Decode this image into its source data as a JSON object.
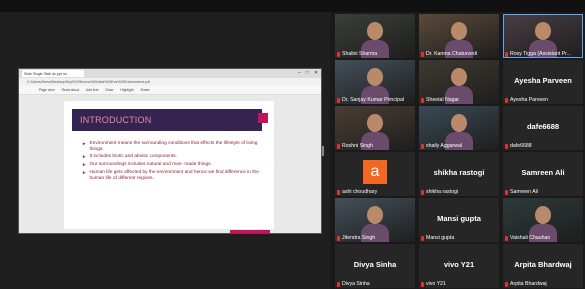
{
  "browser": {
    "tab_title": "Slide Single Slide dc.ppt mi...",
    "window_controls": [
      "–",
      "□",
      "✕"
    ],
    "address": "C:/Users/Hema/Desktop/Sep%20Shrena%20slide%20Evs%20Environment.pdf",
    "pdf_tools": [
      "Page view",
      "Read aloud",
      "Add text",
      "Draw",
      "Highlight",
      "Erase"
    ]
  },
  "slide": {
    "title": "INTRODUCTION",
    "bullets": [
      "Environment means the surrounding conditions that effects the lifestyle of living things.",
      "It includes biotic and abiotic components.",
      "Our surroundings includes natural and man- made things.",
      "Human life gets affected by the environment and hence we find difference in the human life of different regions."
    ],
    "page_number": "1"
  },
  "participants": [
    {
      "name": "Shalini Sharma",
      "display": "video"
    },
    {
      "name": "Dr. Kamna Chaturvedi",
      "display": "video"
    },
    {
      "name": "Rosy Tigga (Assistant Pr...",
      "display": "video"
    },
    {
      "name": "Dr. Sanjay Kumar Principal",
      "display": "video"
    },
    {
      "name": "Sheetal Nagar",
      "display": "video"
    },
    {
      "name": "Ayesha Parveen",
      "display": "name",
      "big": "Ayesha Parveen"
    },
    {
      "name": "Roshni Singh",
      "display": "video"
    },
    {
      "name": "shaily Aggarwal",
      "display": "video"
    },
    {
      "name": "dafe6688",
      "display": "name",
      "big": "dafe6688"
    },
    {
      "name": "ashi choudhary",
      "display": "letter",
      "letter": "a"
    },
    {
      "name": "shikha rastogi",
      "display": "name",
      "big": "shikha rastogi"
    },
    {
      "name": "Samreen Ali",
      "display": "name",
      "big": "Samreen Ali"
    },
    {
      "name": "Jitendra Singh",
      "display": "video"
    },
    {
      "name": "Mansi gupta",
      "display": "name",
      "big": "Mansi gupta"
    },
    {
      "name": "Vaishali Chauhan",
      "display": "video"
    },
    {
      "name": "Divya Sinha",
      "display": "name",
      "big": "Divya Sinha"
    },
    {
      "name": "vivo Y21",
      "display": "name",
      "big": "vivo Y21"
    },
    {
      "name": "Arpita Bhardwaj",
      "display": "name",
      "big": "Arpita Bhardwaj"
    }
  ],
  "colors": {
    "slide_header": "#35244f",
    "accent": "#c0155b",
    "mic_muted": "#e0322f",
    "avatar_letter_bg": "#f26722"
  }
}
